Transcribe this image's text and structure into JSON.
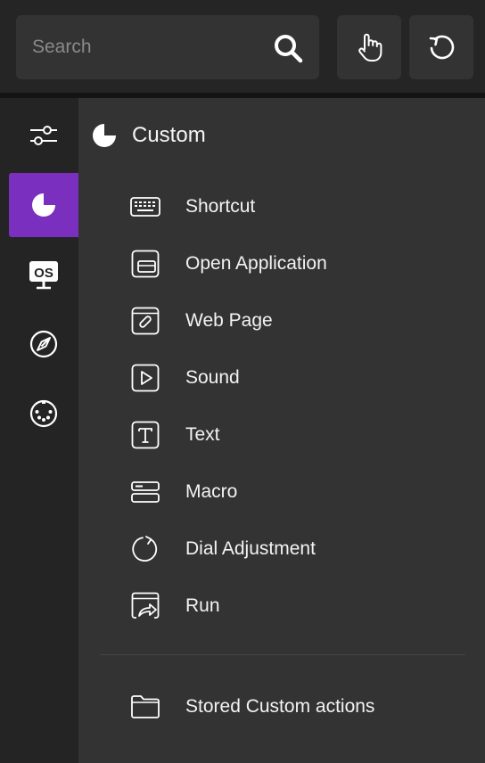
{
  "search": {
    "placeholder": "Search"
  },
  "toolbar": {
    "touch_icon": "hand-pointer-icon",
    "refresh_icon": "refresh-icon"
  },
  "colors": {
    "accent": "#7b2fbf",
    "panel": "#333334",
    "rail": "#242424"
  },
  "rail": {
    "items": [
      {
        "name": "settings-sliders-icon",
        "active": false
      },
      {
        "name": "custom-pie-icon",
        "active": true
      },
      {
        "name": "os-monitor-icon",
        "active": false
      },
      {
        "name": "compass-icon",
        "active": false
      },
      {
        "name": "midi-connector-icon",
        "active": false
      }
    ]
  },
  "panel": {
    "title": "Custom",
    "items": [
      {
        "label": "Shortcut",
        "icon": "keyboard-icon"
      },
      {
        "label": "Open Application",
        "icon": "app-window-icon"
      },
      {
        "label": "Web Page",
        "icon": "web-link-icon"
      },
      {
        "label": "Sound",
        "icon": "play-sound-icon"
      },
      {
        "label": "Text",
        "icon": "text-icon"
      },
      {
        "label": "Macro",
        "icon": "macro-icon"
      },
      {
        "label": "Dial Adjustment",
        "icon": "dial-rotate-icon"
      },
      {
        "label": "Run",
        "icon": "run-window-icon"
      }
    ],
    "stored": {
      "label": "Stored Custom actions",
      "icon": "folder-icon"
    }
  }
}
